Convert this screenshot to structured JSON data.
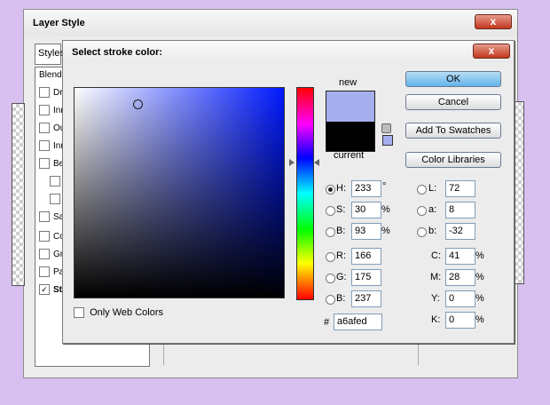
{
  "background_window": {
    "title": "Layer Style",
    "close_label": "x",
    "styles_tab": "Styles",
    "blending_label": "Blendin",
    "layer_style_items": [
      {
        "label": "Dro",
        "checked": false,
        "indent": false
      },
      {
        "label": "Inn",
        "checked": false,
        "indent": false
      },
      {
        "label": "Ou",
        "checked": false,
        "indent": false
      },
      {
        "label": "Inn",
        "checked": false,
        "indent": false
      },
      {
        "label": "Bev",
        "checked": false,
        "indent": false
      },
      {
        "label": "",
        "checked": false,
        "indent": true
      },
      {
        "label": "",
        "checked": false,
        "indent": true
      },
      {
        "label": "Sat",
        "checked": false,
        "indent": false
      },
      {
        "label": "Co",
        "checked": false,
        "indent": false
      },
      {
        "label": "Gra",
        "checked": false,
        "indent": false
      },
      {
        "label": "Pat",
        "checked": false,
        "indent": false
      },
      {
        "label": "Str",
        "checked": true,
        "indent": false
      }
    ]
  },
  "dialog": {
    "title": "Select stroke color:",
    "close_label": "x",
    "new_label": "new",
    "current_label": "current",
    "new_color": "#a6afed",
    "current_color": "#000000",
    "buttons": {
      "ok": "OK",
      "cancel": "Cancel",
      "add_swatches": "Add To Swatches",
      "color_libraries": "Color Libraries"
    },
    "hsb": {
      "h": {
        "label": "H:",
        "value": "233",
        "unit": "°",
        "selected": true
      },
      "s": {
        "label": "S:",
        "value": "30",
        "unit": "%",
        "selected": false
      },
      "b": {
        "label": "B:",
        "value": "93",
        "unit": "%",
        "selected": false
      }
    },
    "rgb": {
      "r": {
        "label": "R:",
        "value": "166",
        "selected": false
      },
      "g": {
        "label": "G:",
        "value": "175",
        "selected": false
      },
      "b": {
        "label": "B:",
        "value": "237",
        "selected": false
      }
    },
    "lab": {
      "l": {
        "label": "L:",
        "value": "72",
        "selected": false
      },
      "a": {
        "label": "a:",
        "value": "8",
        "selected": false
      },
      "b": {
        "label": "b:",
        "value": "-32",
        "selected": false
      }
    },
    "cmyk": {
      "c": {
        "label": "C:",
        "value": "41",
        "unit": "%"
      },
      "m": {
        "label": "M:",
        "value": "28",
        "unit": "%"
      },
      "y": {
        "label": "Y:",
        "value": "0",
        "unit": "%"
      },
      "k": {
        "label": "K:",
        "value": "0",
        "unit": "%"
      }
    },
    "hex": {
      "label": "#",
      "value": "a6afed"
    },
    "only_web_colors": {
      "label": "Only Web Colors",
      "checked": false
    }
  }
}
